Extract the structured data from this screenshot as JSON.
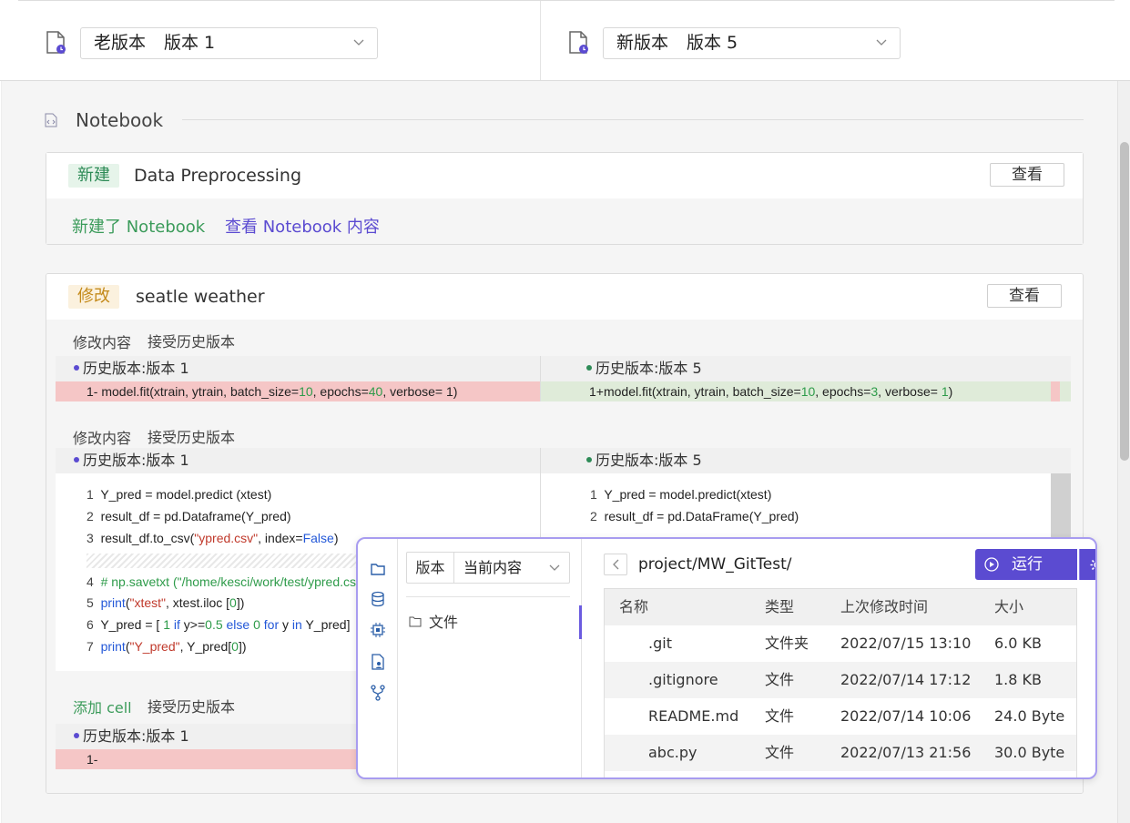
{
  "header": {
    "left": {
      "prefix": "老版本",
      "version": "版本 1"
    },
    "right": {
      "prefix": "新版本",
      "version": "版本 5"
    }
  },
  "section": {
    "title": "Notebook"
  },
  "card1": {
    "tag": "新建",
    "title": "Data Preprocessing",
    "view_label": "查看",
    "body_green": "新建了 Notebook",
    "body_link": "查看 Notebook 内容"
  },
  "card2": {
    "tag": "修改",
    "title": "seatle weather",
    "view_label": "查看",
    "block1": {
      "label": "修改内容",
      "accept": "接受历史版本",
      "left_head": "历史版本:版本 1",
      "right_head": "历史版本:版本 5",
      "left_num": "1-",
      "left_code": "model.fit(xtrain, ytrain, batch_size=10, epochs=40, verbose= 1)",
      "right_num": "1+",
      "right_code": "model.fit(xtrain, ytrain, batch_size=10, epochs=3, verbose= 1)"
    },
    "block2": {
      "label": "修改内容",
      "accept": "接受历史版本",
      "left_head": "历史版本:版本 1",
      "right_head": "历史版本:版本 5",
      "left_lines": [
        {
          "n": "1",
          "code": "Y_pred = model.predict (xtest)"
        },
        {
          "n": "2",
          "code": "result_df = pd.Dataframe(Y_pred)"
        },
        {
          "n": "3",
          "code": "result_df.to_csv(\"ypred.csv\", index=False)"
        },
        {
          "n": "4",
          "code": "# np.savetxt (\"/home/kesci/work/test/ypred.cs"
        },
        {
          "n": "5",
          "code": "print(\"xtest\", xtest.iloc [0])"
        },
        {
          "n": "6",
          "code": "Y_pred = [ 1 if y>=0.5 else 0 for y in Y_pred]"
        },
        {
          "n": "7",
          "code": "print(\"Y_pred\", Y_pred[0])"
        }
      ],
      "right_lines": [
        {
          "n": "1",
          "code": "Y_pred = model.predict(xtest)"
        },
        {
          "n": "2",
          "code": "result_df = pd.DataFrame(Y_pred)"
        }
      ]
    },
    "block3": {
      "label": "添加 cell",
      "accept": "接受历史版本",
      "left_head": "历史版本:版本 1",
      "left_num": "1-"
    }
  },
  "popup": {
    "version_label": "版本",
    "version_value": "当前内容",
    "file_item": "文件",
    "path": "project/MW_GitTest/",
    "run_label": "运行",
    "columns": [
      "名称",
      "类型",
      "上次修改时间",
      "大小"
    ],
    "rows": [
      {
        "name": ".git",
        "type": "文件夹",
        "time": "2022/07/15 13:10",
        "size": "6.0 KB"
      },
      {
        "name": ".gitignore",
        "type": "文件",
        "time": "2022/07/14 17:12",
        "size": "1.8 KB"
      },
      {
        "name": "README.md",
        "type": "文件",
        "time": "2022/07/14 10:06",
        "size": "24.0 Byte"
      },
      {
        "name": "abc.py",
        "type": "文件",
        "time": "2022/07/13 21:56",
        "size": "30.0 Byte"
      }
    ]
  },
  "colors": {
    "accent": "#5b4bd1",
    "green": "#3b9b5a",
    "removed": "#f5c6c6",
    "added": "#dfebd9"
  }
}
